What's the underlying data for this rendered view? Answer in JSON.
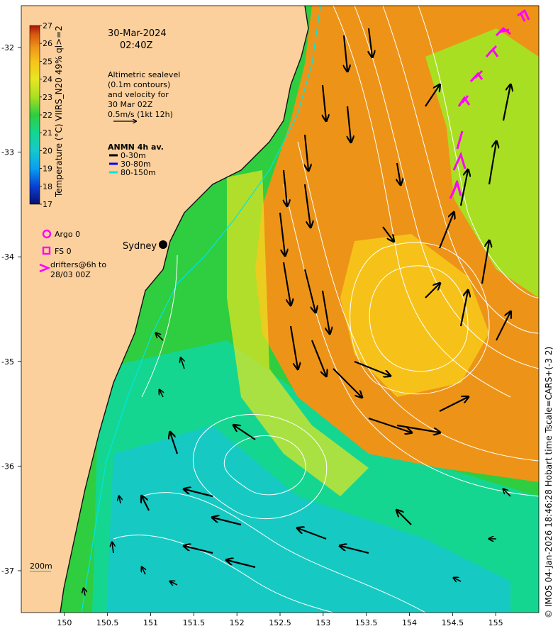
{
  "colorbar": {
    "label": "Temperature (°C) VIIRS_N20 49% ql>=2",
    "ticks": [
      "27",
      "26",
      "25",
      "24",
      "23",
      "22",
      "21",
      "20",
      "19",
      "18",
      "17"
    ],
    "range": [
      17,
      27
    ],
    "colors": [
      "#08106e",
      "#0a3fd6",
      "#0a9ff0",
      "#16c8cc",
      "#14d690",
      "#2fcd40",
      "#a9df22",
      "#e8e622",
      "#f6c21a",
      "#ed9418",
      "#d7580f",
      "#a81408"
    ]
  },
  "timestamp": {
    "date": "30-Mar-2024",
    "time": "02:40Z"
  },
  "notes": {
    "lines": [
      "Altimetric sealevel",
      "(0.1m contours)",
      "and velocity for",
      "30 Mar 02Z",
      "0.5m/s (1kt 12h)"
    ]
  },
  "anmn": {
    "title": "ANMN 4h av.",
    "items": [
      {
        "label": "0-30m",
        "color": "#000000"
      },
      {
        "label": "30-80m",
        "color": "#0000ff"
      },
      {
        "label": "80-150m",
        "color": "#00e5e5"
      }
    ]
  },
  "markers": {
    "argo": "Argo 0",
    "fs": "FS 0",
    "drifters_l1": "drifters@6h to",
    "drifters_l2": "28/03 00Z",
    "color": "#ff00ff"
  },
  "city": "Sydney",
  "isobath": "200m",
  "axes": {
    "lat_ticks": [
      "-32",
      "-33",
      "-34",
      "-35",
      "-36",
      "-37"
    ],
    "lon_ticks": [
      "150",
      "150.5",
      "151",
      "151.5",
      "152",
      "152.5",
      "153",
      "153.5",
      "154",
      "154.5",
      "155"
    ],
    "lat_range": [
      -37.4,
      -31.6
    ],
    "lon_range": [
      149.5,
      155.5
    ]
  },
  "credit": "© IMOS 04-Jan-2026 18:46:28 Hobart time Tscale=CARS+(-3 2)",
  "colors": {
    "land": "#fcd09c",
    "coast": "#111111",
    "contour": "#ffffff",
    "shelf": "#00e5e5"
  }
}
